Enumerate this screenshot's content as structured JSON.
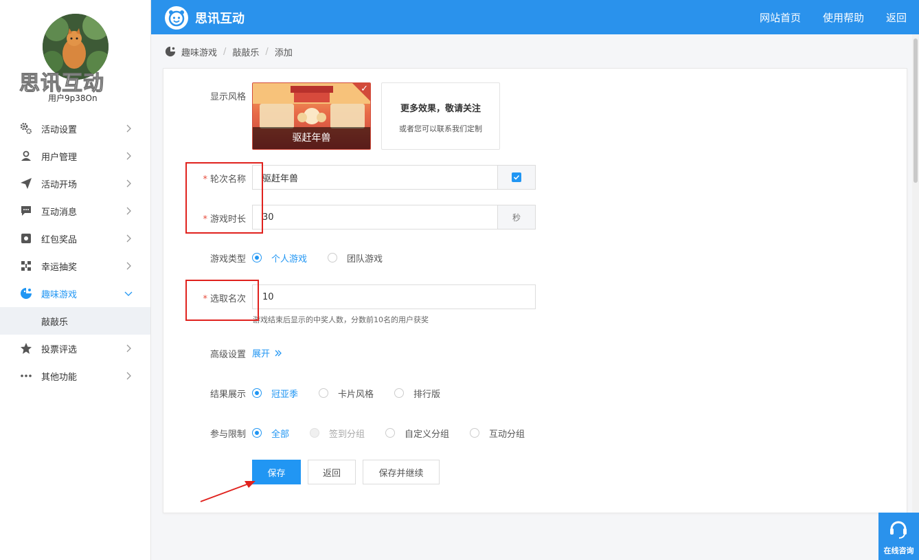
{
  "sidebar": {
    "brand": "思讯互动",
    "username": "用户9p38On",
    "items": [
      {
        "label": "活动设置",
        "icon": "gears-icon"
      },
      {
        "label": "用户管理",
        "icon": "user-manage-icon"
      },
      {
        "label": "活动开场",
        "icon": "paper-plane-icon"
      },
      {
        "label": "互动消息",
        "icon": "chat-bubble-icon"
      },
      {
        "label": "红包奖品",
        "icon": "gift-icon"
      },
      {
        "label": "幸运抽奖",
        "icon": "lottery-icon"
      },
      {
        "label": "趣味游戏",
        "icon": "game-icon",
        "active": true
      },
      {
        "label": "投票评选",
        "icon": "star-icon"
      },
      {
        "label": "其他功能",
        "icon": "more-dots-icon"
      }
    ],
    "subitem": "敲敲乐"
  },
  "topbar": {
    "logo": "思讯互动",
    "links": [
      "网站首页",
      "使用帮助",
      "返回"
    ]
  },
  "breadcrumb": [
    "趣味游戏",
    "敲敲乐",
    "添加"
  ],
  "form": {
    "style_label": "显示风格",
    "game_card_caption": "驱赶年兽",
    "more_title": "更多效果，敬请关注",
    "more_sub": "或者您可以联系我们定制",
    "round_label": "轮次名称",
    "round_value": "驱赶年兽",
    "duration_label": "游戏时长",
    "duration_value": "30",
    "duration_unit": "秒",
    "type_label": "游戏类型",
    "type_options": [
      "个人游戏",
      "团队游戏"
    ],
    "rank_label": "选取名次",
    "rank_value": "10",
    "rank_hint": "游戏结束后显示的中奖人数，分数前10名的用户获奖",
    "advanced_label": "高级设置",
    "advanced_link": "展开",
    "result_label": "结果展示",
    "result_options": [
      "冠亚季",
      "卡片风格",
      "排行版"
    ],
    "limit_label": "参与限制",
    "limit_options": [
      "全部",
      "签到分组",
      "自定义分组",
      "互动分组"
    ]
  },
  "buttons": {
    "save": "保存",
    "back": "返回",
    "save_continue": "保存并继续"
  },
  "consult": "在线咨询",
  "colors": {
    "primary": "#2196f3",
    "topbar": "#2a92ec",
    "annotation": "#e0211d"
  }
}
